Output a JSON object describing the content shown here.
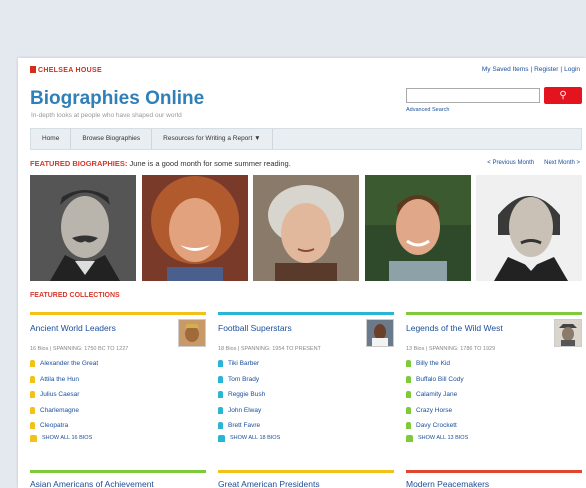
{
  "header": {
    "logo_text": "CHELSEA HOUSE",
    "links": [
      "My Saved Items",
      "Register",
      "Login"
    ],
    "title": "Biographies Online",
    "tagline": "In-depth looks at people who have shaped our world",
    "search": {
      "placeholder": "",
      "advanced_label": "Advanced Search",
      "button_icon": "search-icon"
    }
  },
  "nav": [
    "Home",
    "Browse Biographies",
    "Resources for Writing a Report ▼"
  ],
  "featured": {
    "label": "FEATURED BIOGRAPHIES:",
    "text": "June is a good month for some summer reading.",
    "prev": "< Previous Month",
    "next": "Next Month >"
  },
  "collections_label": "FEATURED COLLECTIONS",
  "collections": [
    {
      "title": "Ancient World Leaders",
      "color": "#f2c21a",
      "meta": "16 Bios | SPANNING: 1750 BC TO 1227",
      "items": [
        "Alexander the Great",
        "Attila the Hun",
        "Julius Caesar",
        "Charlemagne",
        "Cleopatra"
      ],
      "show_all": "SHOW ALL 16 BIOS"
    },
    {
      "title": "Football Superstars",
      "color": "#29b6d6",
      "meta": "18 Bios | SPANNING: 1954 TO PRESENT",
      "items": [
        "Tiki Barber",
        "Tom Brady",
        "Reggie Bush",
        "John Elway",
        "Brett Favre"
      ],
      "show_all": "SHOW ALL 18 BIOS"
    },
    {
      "title": "Legends of the Wild West",
      "color": "#7fca3a",
      "meta": "13 Bios | SPANNING: 1786 TO 1929",
      "items": [
        "Billy the Kid",
        "Buffalo Bill Cody",
        "Calamity Jane",
        "Crazy Horse",
        "Davy Crockett"
      ],
      "show_all": "SHOW ALL 13 BIOS"
    }
  ],
  "next_collections": [
    {
      "title": "Asian Americans of Achievement",
      "color": "#7fca3a"
    },
    {
      "title": "Great American Presidents",
      "color": "#f2c21a"
    },
    {
      "title": "Modern Peacemakers",
      "color": "#e0452e"
    }
  ]
}
